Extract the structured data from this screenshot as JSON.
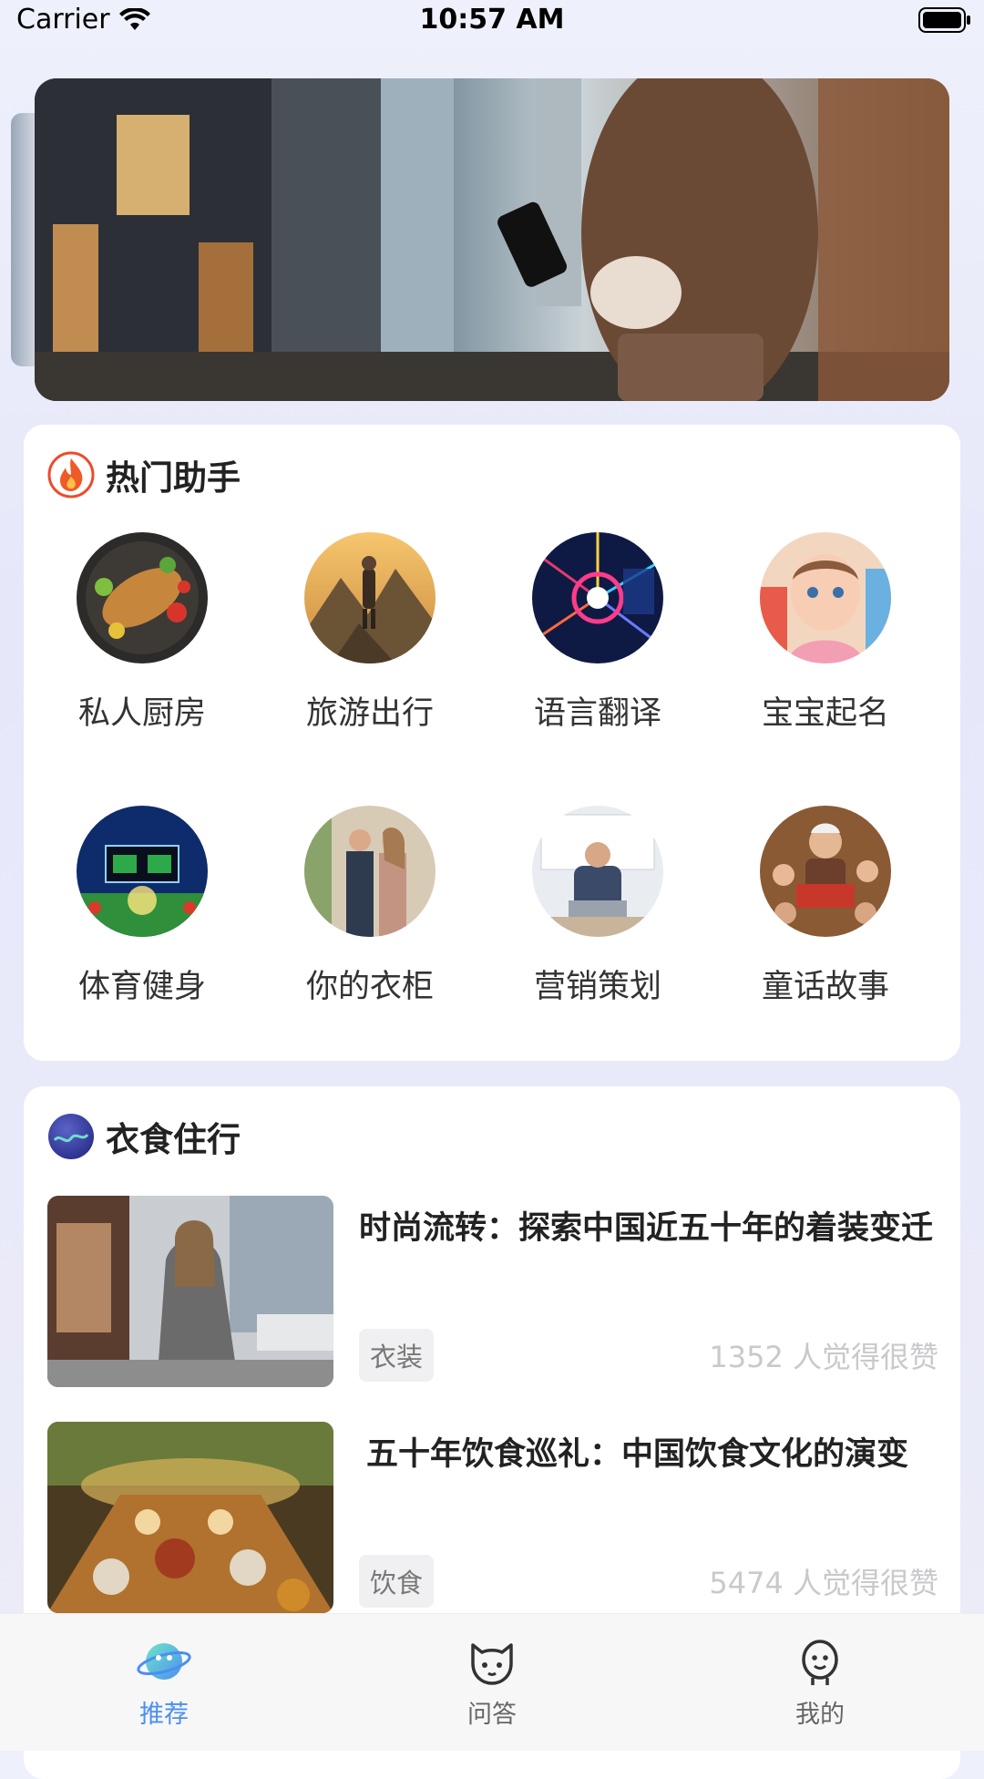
{
  "status_bar": {
    "carrier": "Carrier",
    "time": "10:57 AM"
  },
  "banner": {
    "image": "city-street-woman-phone"
  },
  "hot_assistants": {
    "title": "热门助手",
    "icon": "flame-icon",
    "items": [
      {
        "label": "私人厨房",
        "image": "food-platter"
      },
      {
        "label": "旅游出行",
        "image": "hiker-mountain"
      },
      {
        "label": "语言翻译",
        "image": "translation-tech"
      },
      {
        "label": "宝宝起名",
        "image": "baby-portrait"
      },
      {
        "label": "体育健身",
        "image": "sports-stadium"
      },
      {
        "label": "你的衣柜",
        "image": "fashion-couple"
      },
      {
        "label": "营销策划",
        "image": "office-man-laptop"
      },
      {
        "label": "童话故事",
        "image": "grandpa-storybook"
      }
    ]
  },
  "lifestyle": {
    "title": "衣食住行",
    "icon": "globe-icon",
    "articles": [
      {
        "title": "时尚流转：探索中国近五十年的着装变迁",
        "tag": "衣装",
        "likes": "1352 人觉得很赞",
        "image": "fashion-woman-street"
      },
      {
        "title": "五十年饮食巡礼：中国饮食文化的演变",
        "tag": "饮食",
        "likes": "5474 人觉得很赞",
        "image": "banquet-table"
      }
    ]
  },
  "tab_bar": {
    "tabs": [
      {
        "label": "推荐",
        "icon": "planet-icon",
        "active": true
      },
      {
        "label": "问答",
        "icon": "cat-face-icon",
        "active": false
      },
      {
        "label": "我的",
        "icon": "person-face-icon",
        "active": false
      }
    ]
  },
  "colors": {
    "accent": "#4b8ef1",
    "likes": "#c9c9cc",
    "title": "#222222"
  }
}
